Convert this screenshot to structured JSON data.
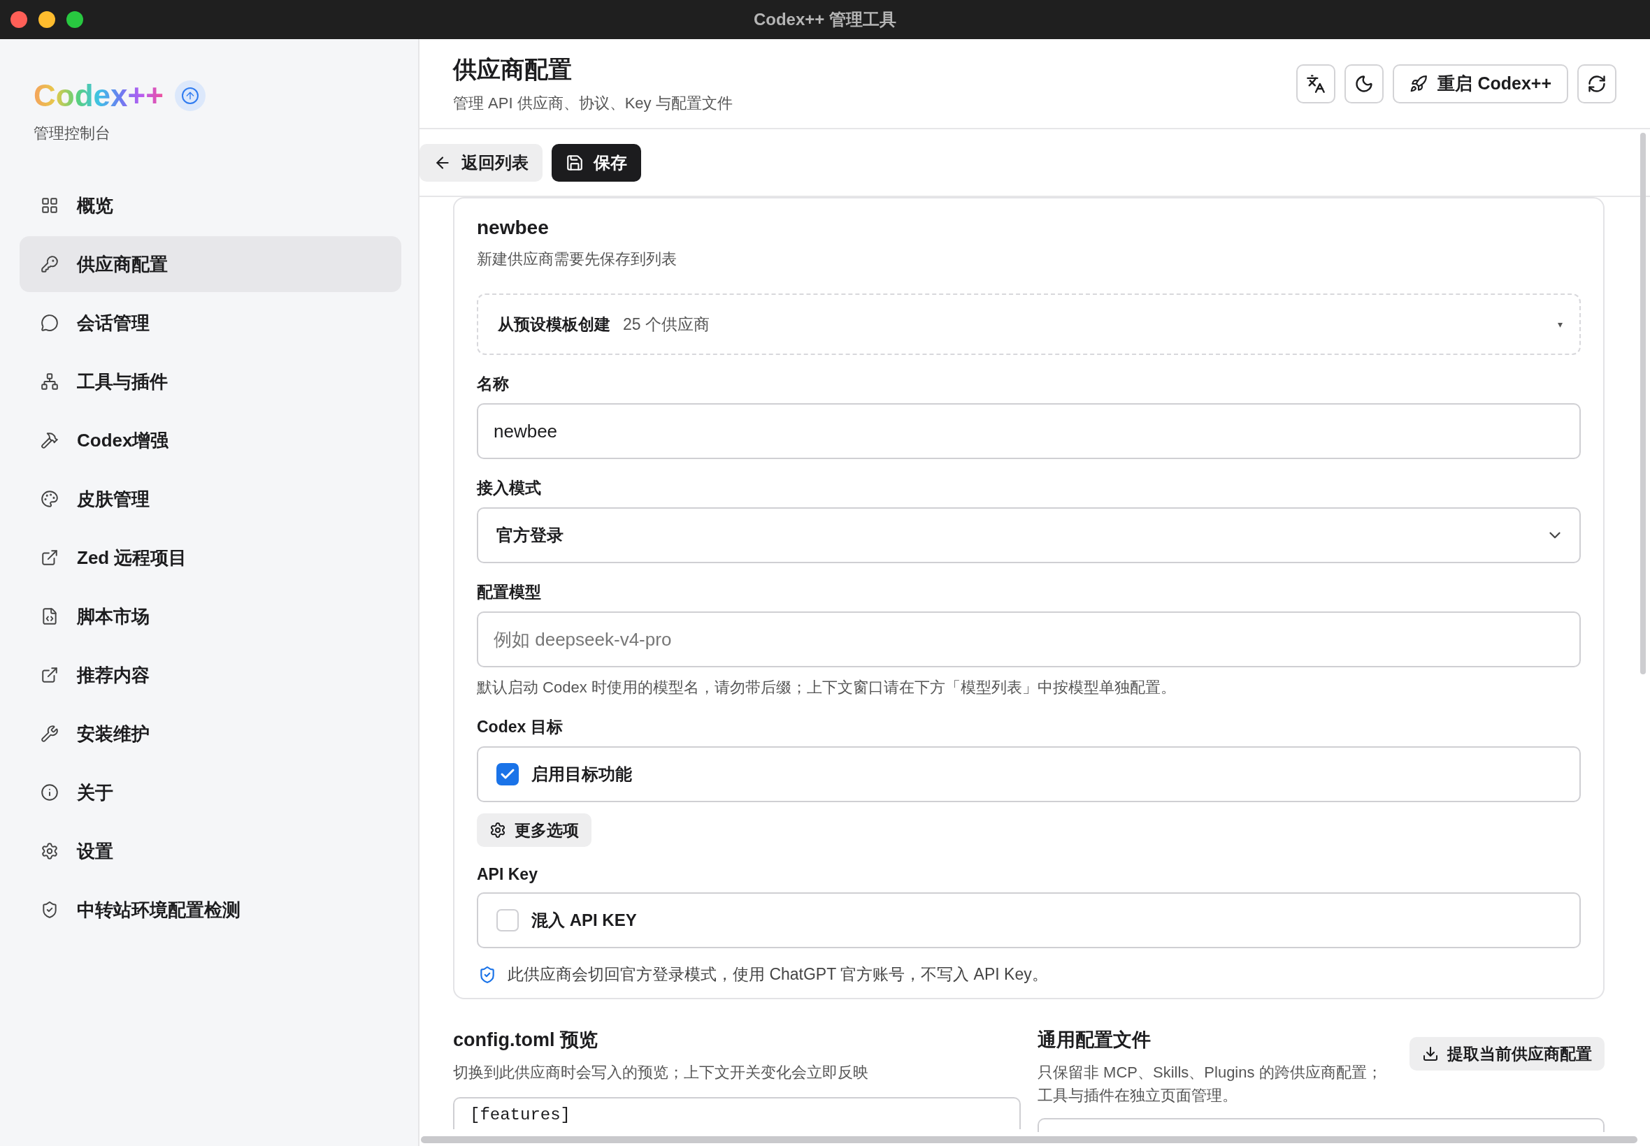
{
  "window": {
    "title": "Codex++ 管理工具"
  },
  "sidebar": {
    "logo": "Codex++",
    "logo_subtitle": "管理控制台",
    "items": [
      {
        "label": "概览",
        "selected": false
      },
      {
        "label": "供应商配置",
        "selected": true
      },
      {
        "label": "会话管理",
        "selected": false
      },
      {
        "label": "工具与插件",
        "selected": false
      },
      {
        "label": "Codex增强",
        "selected": false
      },
      {
        "label": "皮肤管理",
        "selected": false
      },
      {
        "label": "Zed 远程项目",
        "selected": false
      },
      {
        "label": "脚本市场",
        "selected": false
      },
      {
        "label": "推荐内容",
        "selected": false
      },
      {
        "label": "安装维护",
        "selected": false
      },
      {
        "label": "关于",
        "selected": false
      },
      {
        "label": "设置",
        "selected": false
      },
      {
        "label": "中转站环境配置检测",
        "selected": false
      }
    ]
  },
  "header": {
    "title": "供应商配置",
    "subtitle": "管理 API 供应商、协议、Key 与配置文件",
    "restart_button": "重启 Codex++"
  },
  "toolbar": {
    "back_button": "返回列表",
    "save_button": "保存"
  },
  "card": {
    "title": "newbee",
    "subtitle": "新建供应商需要先保存到列表",
    "template": {
      "label": "从预设模板创建",
      "count": "25 个供应商",
      "caret": "▾"
    },
    "name": {
      "label": "名称",
      "value": "newbee"
    },
    "mode": {
      "label": "接入模式",
      "value": "官方登录"
    },
    "model": {
      "label": "配置模型",
      "placeholder": "例如 deepseek-v4-pro",
      "hint": "默认启动 Codex 时使用的模型名，请勿带后缀；上下文窗口请在下方「模型列表」中按模型单独配置。"
    },
    "goal": {
      "label": "Codex 目标",
      "option": "启用目标功能",
      "checked": true
    },
    "more_button": "更多选项",
    "api_key": {
      "label": "API Key",
      "option": "混入 API KEY",
      "checked": false
    },
    "notice": "此供应商会切回官方登录模式，使用 ChatGPT 官方账号，不写入 API Key。"
  },
  "preview": {
    "title": "config.toml 预览",
    "subtitle": "切换到此供应商时会写入的预览；上下文开关变化会立即反映",
    "code": "[features]"
  },
  "common": {
    "title": "通用配置文件",
    "subtitle": "只保留非 MCP、Skills、Plugins 的跨供应商配置；工具与插件在独立页面管理。",
    "button": "提取当前供应商配置"
  }
}
